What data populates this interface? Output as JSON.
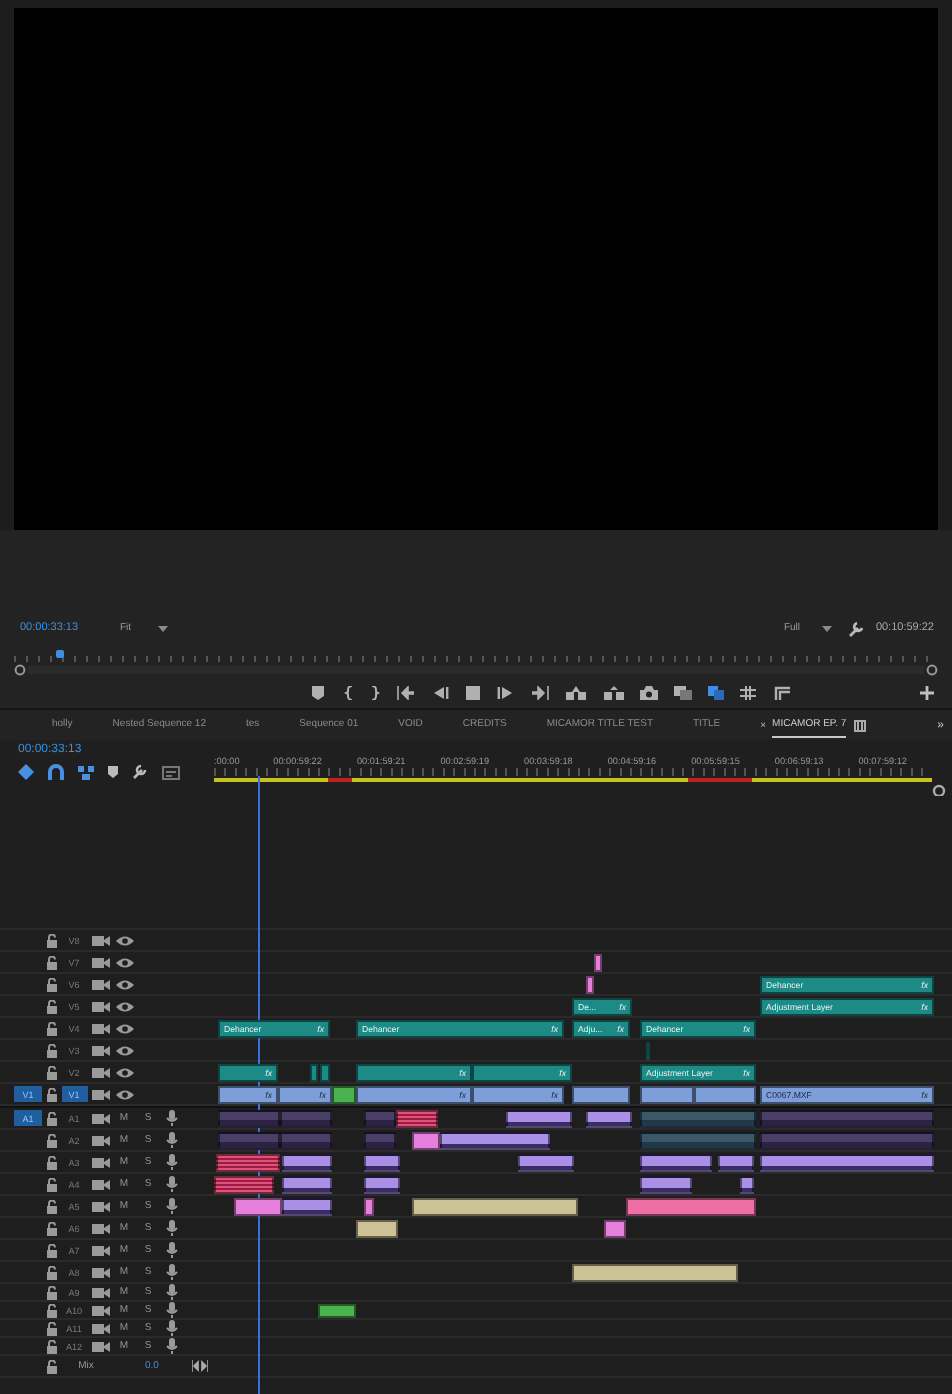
{
  "program_monitor": {
    "timecode": "00:00:33:13",
    "zoom": "Fit",
    "resolution": "Full",
    "duration": "00:10:59:22"
  },
  "sequence_tabs": [
    {
      "label": "holly",
      "selected": false
    },
    {
      "label": "Nested Sequence 12",
      "selected": false
    },
    {
      "label": "tes",
      "selected": false
    },
    {
      "label": "Sequence 01",
      "selected": false
    },
    {
      "label": "VOID",
      "selected": false
    },
    {
      "label": "CREDITS",
      "selected": false
    },
    {
      "label": "MICAMOR TITLE TEST",
      "selected": false
    },
    {
      "label": "TITLE",
      "selected": false
    },
    {
      "label": "MICAMOR EP. 7",
      "selected": true,
      "close": "×"
    }
  ],
  "tabs_overflow": "»",
  "timeline": {
    "timecode": "00:00:33:13",
    "ruler_labels": [
      ":00:00",
      "00:00:59:22",
      "00:01:59:21",
      "00:02:59:19",
      "00:03:59:18",
      "00:04:59:16",
      "00:05:59:15",
      "00:06:59:13",
      "00:07:59:12"
    ],
    "video_tracks": [
      {
        "name": "V8",
        "targeted": false
      },
      {
        "name": "V7",
        "targeted": false,
        "clips": [
          {
            "kind": "pink"
          }
        ]
      },
      {
        "name": "V6",
        "targeted": false,
        "clips": [
          {
            "kind": "pink"
          },
          {
            "kind": "teal",
            "label": "Dehancer",
            "badge": "fx"
          }
        ]
      },
      {
        "name": "V5",
        "targeted": false,
        "clips": [
          {
            "kind": "teal",
            "label": "De...",
            "badge": "fx"
          },
          {
            "kind": "teal",
            "label": "Adjustment Layer",
            "badge": "fx"
          }
        ]
      },
      {
        "name": "V4",
        "targeted": false,
        "clips": [
          {
            "kind": "teal",
            "label": "Dehancer",
            "badge": "fx"
          },
          {
            "kind": "teal",
            "label": "Dehancer",
            "badge": "fx"
          },
          {
            "kind": "teal",
            "label": "Adju...",
            "badge": "fx"
          },
          {
            "kind": "teal",
            "label": "Dehancer",
            "badge": "fx"
          }
        ]
      },
      {
        "name": "V3",
        "targeted": false,
        "clips": [
          {
            "kind": "teal"
          }
        ]
      },
      {
        "name": "V2",
        "targeted": false,
        "clips": [
          {
            "kind": "teal",
            "badge": "fx"
          },
          {
            "kind": "teal"
          },
          {
            "kind": "teal"
          },
          {
            "kind": "teal",
            "badge": "fx"
          },
          {
            "kind": "teal",
            "badge": "fx"
          },
          {
            "kind": "teal",
            "label": "Adjustment Layer",
            "badge": "fx"
          }
        ]
      },
      {
        "name": "V1",
        "targeted": true,
        "source_patch": "V1",
        "clips": [
          {
            "kind": "blue",
            "badge": "fx"
          },
          {
            "kind": "blue",
            "badge": "fx"
          },
          {
            "kind": "green"
          },
          {
            "kind": "blue",
            "badge": "fx"
          },
          {
            "kind": "blue",
            "badge": "fx"
          },
          {
            "kind": "blue"
          },
          {
            "kind": "blue"
          },
          {
            "kind": "blue"
          },
          {
            "kind": "blue",
            "label": "C0067.MXF",
            "badge": "fx"
          }
        ]
      }
    ],
    "audio_tracks": [
      {
        "name": "A1",
        "targeted": false,
        "source_patch": "A1",
        "mute": "M",
        "solo": "S",
        "clips": [
          {
            "kind": "dark"
          },
          {
            "kind": "dark"
          },
          {
            "kind": "dark"
          },
          {
            "kind": "red"
          },
          {
            "kind": "lilac"
          },
          {
            "kind": "lilac"
          },
          {
            "kind": "slate"
          },
          {
            "kind": "dark"
          }
        ]
      },
      {
        "name": "A2",
        "targeted": false,
        "mute": "M",
        "solo": "S",
        "clips": [
          {
            "kind": "dark"
          },
          {
            "kind": "dark"
          },
          {
            "kind": "dark"
          },
          {
            "kind": "pink"
          },
          {
            "kind": "lilac"
          },
          {
            "kind": "slate"
          },
          {
            "kind": "dark"
          }
        ]
      },
      {
        "name": "A3",
        "targeted": false,
        "mute": "M",
        "solo": "S",
        "clips": [
          {
            "kind": "red"
          },
          {
            "kind": "lilac"
          },
          {
            "kind": "lilac"
          },
          {
            "kind": "lilac"
          },
          {
            "kind": "lilac"
          },
          {
            "kind": "lilac"
          },
          {
            "kind": "lilac"
          }
        ]
      },
      {
        "name": "A4",
        "targeted": false,
        "mute": "M",
        "solo": "S",
        "clips": [
          {
            "kind": "red"
          },
          {
            "kind": "lilac"
          },
          {
            "kind": "lilac"
          },
          {
            "kind": "lilac"
          },
          {
            "kind": "lilac"
          }
        ]
      },
      {
        "name": "A5",
        "targeted": false,
        "mute": "M",
        "solo": "S",
        "clips": [
          {
            "kind": "pink"
          },
          {
            "kind": "lilac"
          },
          {
            "kind": "pink"
          },
          {
            "kind": "tan"
          },
          {
            "kind": "rose"
          }
        ]
      },
      {
        "name": "A6",
        "targeted": false,
        "mute": "M",
        "solo": "S",
        "clips": [
          {
            "kind": "tan"
          },
          {
            "kind": "pink"
          }
        ]
      },
      {
        "name": "A7",
        "targeted": false,
        "mute": "M",
        "solo": "S"
      },
      {
        "name": "A8",
        "targeted": false,
        "mute": "M",
        "solo": "S",
        "clips": [
          {
            "kind": "tan"
          }
        ]
      },
      {
        "name": "A9",
        "targeted": false,
        "mute": "M",
        "solo": "S"
      },
      {
        "name": "A10",
        "targeted": false,
        "mute": "M",
        "solo": "S",
        "clips": [
          {
            "kind": "green"
          }
        ]
      },
      {
        "name": "A11",
        "targeted": false,
        "mute": "M",
        "solo": "S"
      },
      {
        "name": "A12",
        "targeted": false,
        "mute": "M",
        "solo": "S"
      }
    ],
    "mix": {
      "name": "Mix",
      "volume": "0.0"
    }
  }
}
